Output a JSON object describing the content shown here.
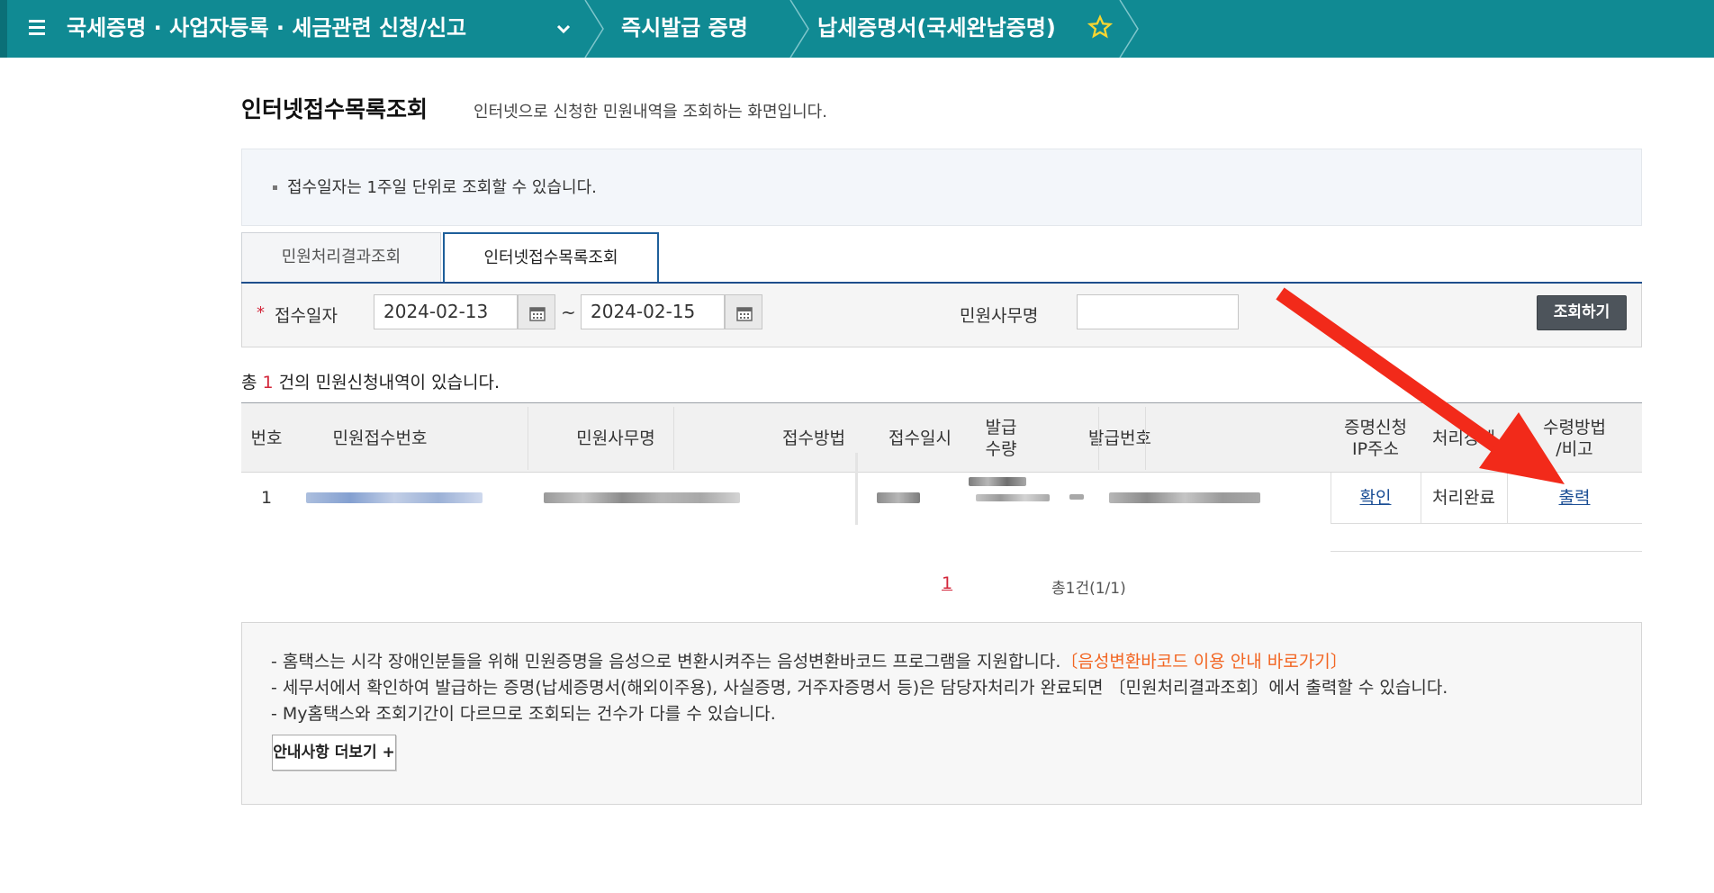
{
  "topbar": {
    "bg_color": "#108a93",
    "menu_icon": "hamburger-icon",
    "crumb1": "국세증명 · 사업자등록 · 세금관련 신청/신고",
    "crumb2": "즉시발급 증명",
    "crumb3": "납세증명서(국세완납증명)",
    "favorite_icon": "star-outline-icon",
    "dropdown_icon": "chevron-down-icon"
  },
  "page": {
    "title": "인터넷접수목록조회",
    "description": "인터넷으로 신청한 민원내역을 조회하는 화면입니다."
  },
  "notice": {
    "text": "접수일자는 1주일 단위로 조회할 수 있습니다."
  },
  "tabs": [
    {
      "label": "민원처리결과조회",
      "active": false
    },
    {
      "label": "인터넷접수목록조회",
      "active": true
    }
  ],
  "search": {
    "required_mark": "*",
    "date_label": "접수일자",
    "date_from": "2024-02-13",
    "date_to": "2024-02-15",
    "range_sep": "~",
    "calendar_icon": "calendar-icon",
    "office_label": "민원사무명",
    "office_value": "",
    "button_label": "조회하기"
  },
  "result_count": {
    "prefix": "총",
    "count": "1",
    "suffix": "건의 민원신청내역이 있습니다."
  },
  "table": {
    "headers": [
      "번호",
      "민원접수번호",
      "민원사무명",
      "접수방법",
      "접수일시",
      "발급\n수량",
      "발급번호",
      "증명신청\nIP주소",
      "처리상태",
      "수령방법\n/비고"
    ],
    "rows": [
      {
        "no": "1",
        "ip_link": "확인",
        "status": "처리완료",
        "receive_link": "출력"
      }
    ]
  },
  "pagination": {
    "current": "1",
    "total": "총1건(1/1)"
  },
  "info": {
    "line1": "- 홈택스는 시각 장애인분들을 위해 민원증명을 음성으로 변환시켜주는 음성변환바코드 프로그램을 지원합니다.",
    "line1_link": "〔음성변환바코드 이용 안내 바로가기〕",
    "line2": "- 세무서에서 확인하여 발급하는 증명(납세증명서(해외이주용), 사실증명, 거주자증명서 등)은 담당자처리가 완료되면 〔민원처리결과조회〕에서 출력할 수 있습니다.",
    "line3": "- My홈택스와 조회기간이 다르므로 조회되는 건수가 다를 수 있습니다.",
    "more_button": "안내사항 더보기 +"
  },
  "annotation": {
    "arrow_color": "#f22a1a"
  }
}
